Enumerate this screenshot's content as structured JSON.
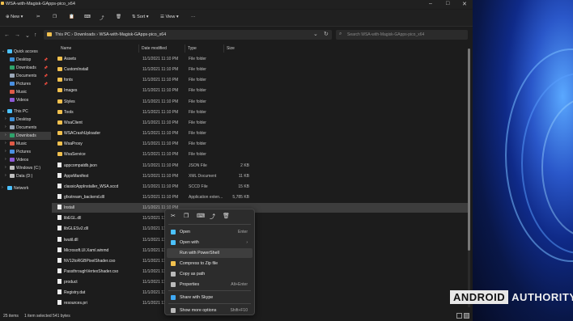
{
  "window": {
    "title": "WSA-with-Magisk-GApps-pico_x64"
  },
  "toolbar": {
    "new_label": "New",
    "sort_label": "Sort",
    "view_label": "View",
    "more_label": "···"
  },
  "address": {
    "path": "This PC  ›  Downloads  ›  WSA-with-Magisk-GApps-pico_x64"
  },
  "search": {
    "placeholder": "Search WSA-with-Magisk-GApps-pico_x64"
  },
  "sidebar": {
    "items": [
      {
        "label": "Quick access",
        "icon": "star-icon"
      },
      {
        "label": "Desktop",
        "icon": "desktop-icon"
      },
      {
        "label": "Downloads",
        "icon": "download-icon"
      },
      {
        "label": "Documents",
        "icon": "document-icon"
      },
      {
        "label": "Pictures",
        "icon": "picture-icon"
      },
      {
        "label": "Music",
        "icon": "music-icon"
      },
      {
        "label": "Videos",
        "icon": "video-icon"
      },
      {
        "label": "This PC",
        "icon": "computer-icon"
      },
      {
        "label": "Desktop",
        "icon": "desktop-icon"
      },
      {
        "label": "Documents",
        "icon": "document-icon"
      },
      {
        "label": "Downloads",
        "icon": "download-icon"
      },
      {
        "label": "Music",
        "icon": "music-icon"
      },
      {
        "label": "Pictures",
        "icon": "picture-icon"
      },
      {
        "label": "Videos",
        "icon": "video-icon"
      },
      {
        "label": "Windows (C:)",
        "icon": "drive-icon"
      },
      {
        "label": "Data (D:)",
        "icon": "drive-icon"
      },
      {
        "label": "Network",
        "icon": "network-icon"
      }
    ]
  },
  "columns": {
    "name": "Name",
    "date": "Date modified",
    "type": "Type",
    "size": "Size"
  },
  "files": [
    {
      "name": "Assets",
      "date": "11/1/2021 11:10 PM",
      "type": "File folder",
      "size": "",
      "kind": "folder"
    },
    {
      "name": "CustomInstall",
      "date": "11/1/2021 11:10 PM",
      "type": "File folder",
      "size": "",
      "kind": "folder"
    },
    {
      "name": "fonts",
      "date": "11/1/2021 11:10 PM",
      "type": "File folder",
      "size": "",
      "kind": "folder"
    },
    {
      "name": "Images",
      "date": "11/1/2021 11:10 PM",
      "type": "File folder",
      "size": "",
      "kind": "folder"
    },
    {
      "name": "Styles",
      "date": "11/1/2021 11:10 PM",
      "type": "File folder",
      "size": "",
      "kind": "folder"
    },
    {
      "name": "Tools",
      "date": "11/1/2021 11:10 PM",
      "type": "File folder",
      "size": "",
      "kind": "folder"
    },
    {
      "name": "WsaClient",
      "date": "11/1/2021 11:10 PM",
      "type": "File folder",
      "size": "",
      "kind": "folder"
    },
    {
      "name": "WSACrashUploader",
      "date": "11/1/2021 11:10 PM",
      "type": "File folder",
      "size": "",
      "kind": "folder"
    },
    {
      "name": "WsaProxy",
      "date": "11/1/2021 11:10 PM",
      "type": "File folder",
      "size": "",
      "kind": "folder"
    },
    {
      "name": "WsaService",
      "date": "11/1/2021 11:10 PM",
      "type": "File folder",
      "size": "",
      "kind": "folder"
    },
    {
      "name": "appcompatdb.json",
      "date": "11/1/2021 11:10 PM",
      "type": "JSON File",
      "size": "2 KB",
      "kind": "file"
    },
    {
      "name": "AppxManifest",
      "date": "11/1/2021 11:10 PM",
      "type": "XML Document",
      "size": "11 KB",
      "kind": "file"
    },
    {
      "name": "classicAppInstaller_WSA.sccd",
      "date": "11/1/2021 11:10 PM",
      "type": "SCCD File",
      "size": "15 KB",
      "kind": "file"
    },
    {
      "name": "gfxstream_backend.dll",
      "date": "11/1/2021 11:10 PM",
      "type": "Application exten...",
      "size": "5,785 KB",
      "kind": "file"
    },
    {
      "name": "Install",
      "date": "11/1/2021 11:10 PM",
      "type": "",
      "size": "",
      "kind": "file"
    },
    {
      "name": "libEGL.dll",
      "date": "11/1/2021 11:10 PM",
      "type": "",
      "size": "",
      "kind": "file"
    },
    {
      "name": "libGLESv2.dll",
      "date": "11/1/2021 11:10 PM",
      "type": "",
      "size": "",
      "kind": "file"
    },
    {
      "name": "lwutil.dll",
      "date": "11/1/2021 11:10 PM",
      "type": "",
      "size": "",
      "kind": "file"
    },
    {
      "name": "Microsoft.UI.Xaml.winmd",
      "date": "11/1/2021 11:10 PM",
      "type": "",
      "size": "",
      "kind": "file"
    },
    {
      "name": "NV12toRGBPixelShader.cso",
      "date": "11/1/2021 11:10 PM",
      "type": "",
      "size": "",
      "kind": "file"
    },
    {
      "name": "PassthroughVertexShader.cso",
      "date": "11/1/2021 11:10 PM",
      "type": "",
      "size": "",
      "kind": "file"
    },
    {
      "name": "product",
      "date": "11/1/2021 11:10 PM",
      "type": "",
      "size": "",
      "kind": "file"
    },
    {
      "name": "Registry.dat",
      "date": "11/1/2021 11:10 PM",
      "type": "",
      "size": "",
      "kind": "file"
    },
    {
      "name": "resources.pri",
      "date": "11/1/2021 11:10 PM",
      "type": "",
      "size": "",
      "kind": "file"
    }
  ],
  "context_menu": {
    "items": [
      {
        "label": "Open",
        "key": "Enter",
        "icon": "open-icon"
      },
      {
        "label": "Open with",
        "key": "›",
        "icon": "open-with-icon"
      },
      {
        "label": "Run with PowerShell",
        "key": "",
        "icon": ""
      },
      {
        "label": "Compress to Zip file",
        "key": "",
        "icon": "zip-icon"
      },
      {
        "label": "Copy as path",
        "key": "",
        "icon": "copy-path-icon"
      },
      {
        "label": "Properties",
        "key": "Alt+Enter",
        "icon": "properties-icon"
      },
      {
        "label": "Share with Skype",
        "key": "",
        "icon": "skype-icon"
      },
      {
        "label": "Show more options",
        "key": "Shift+F10",
        "icon": "more-options-icon"
      }
    ]
  },
  "status": {
    "count": "25 items",
    "selected": "1 item selected  541 bytes"
  },
  "watermark": {
    "a": "ANDROID",
    "b": "AUTHORITY"
  },
  "colors": {
    "folder": "#f2c14e",
    "accent": "#4cc2ff",
    "selection": "#3d3d3d"
  }
}
